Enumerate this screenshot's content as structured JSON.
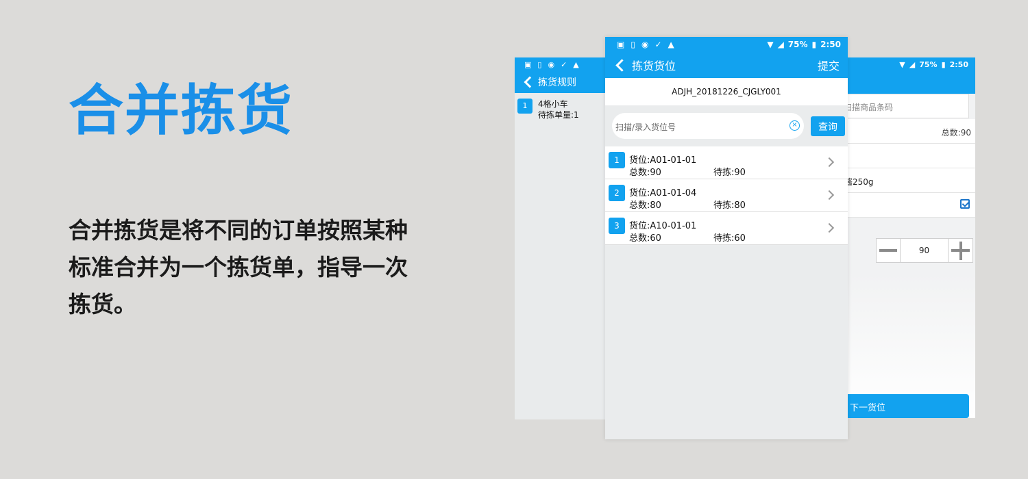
{
  "hero": {
    "title": "合并拣货",
    "description": "合并拣货是将不同的订单按照某种标准合并为一个拣货单，指导一次拣货。"
  },
  "status_bar": {
    "battery": "75%",
    "time": "2:50",
    "icons": [
      "image-icon",
      "sim-icon",
      "shield-icon",
      "check-icon",
      "warning-icon",
      "wifi-icon",
      "signal-icon",
      "battery-icon"
    ]
  },
  "left_screen": {
    "title": "拣货规则",
    "rule": {
      "index": "1",
      "name": "4格小车",
      "pending": "待拣单量:1"
    }
  },
  "center_screen": {
    "title": "拣货货位",
    "submit_label": "提交",
    "order_no": "ADJH_20181226_CJGLY001",
    "search": {
      "placeholder": "扫描/录入货位号",
      "button": "查询"
    },
    "slots": [
      {
        "index": "1",
        "location": "货位:A01-01-01",
        "total": "总数:90",
        "pending": "待拣:90"
      },
      {
        "index": "2",
        "location": "货位:A01-01-04",
        "total": "总数:80",
        "pending": "待拣:80"
      },
      {
        "index": "3",
        "location": "货位:A10-01-01",
        "total": "总数:60",
        "pending": "待拣:60"
      }
    ]
  },
  "right_screen": {
    "scan_placeholder": "扫描商品条码",
    "total": "总数:90",
    "product_name": "酱250g",
    "quantity": "90",
    "next_button": "下一货位"
  },
  "colors": {
    "accent": "#12a2ef",
    "title": "#1a8fe8",
    "background": "#dcdbd9"
  }
}
